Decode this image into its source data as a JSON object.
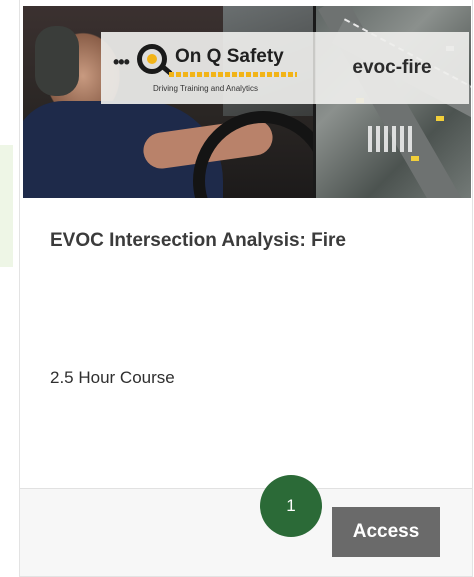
{
  "hero": {
    "logo_brand": "On Q Safety",
    "logo_dots": "•••",
    "logo_tagline": "Driving Training and Analytics",
    "logo_right": "evoc-fire"
  },
  "course": {
    "title": "EVOC Intersection Analysis: Fire",
    "duration": "2.5 Hour Course"
  },
  "footer": {
    "step_badge": "1",
    "access_label": "Access"
  },
  "colors": {
    "badge_green": "#2b6a37",
    "button_gray": "#6a6a6a",
    "logo_yellow": "#f2b418",
    "left_strip": "#eef6e6"
  }
}
